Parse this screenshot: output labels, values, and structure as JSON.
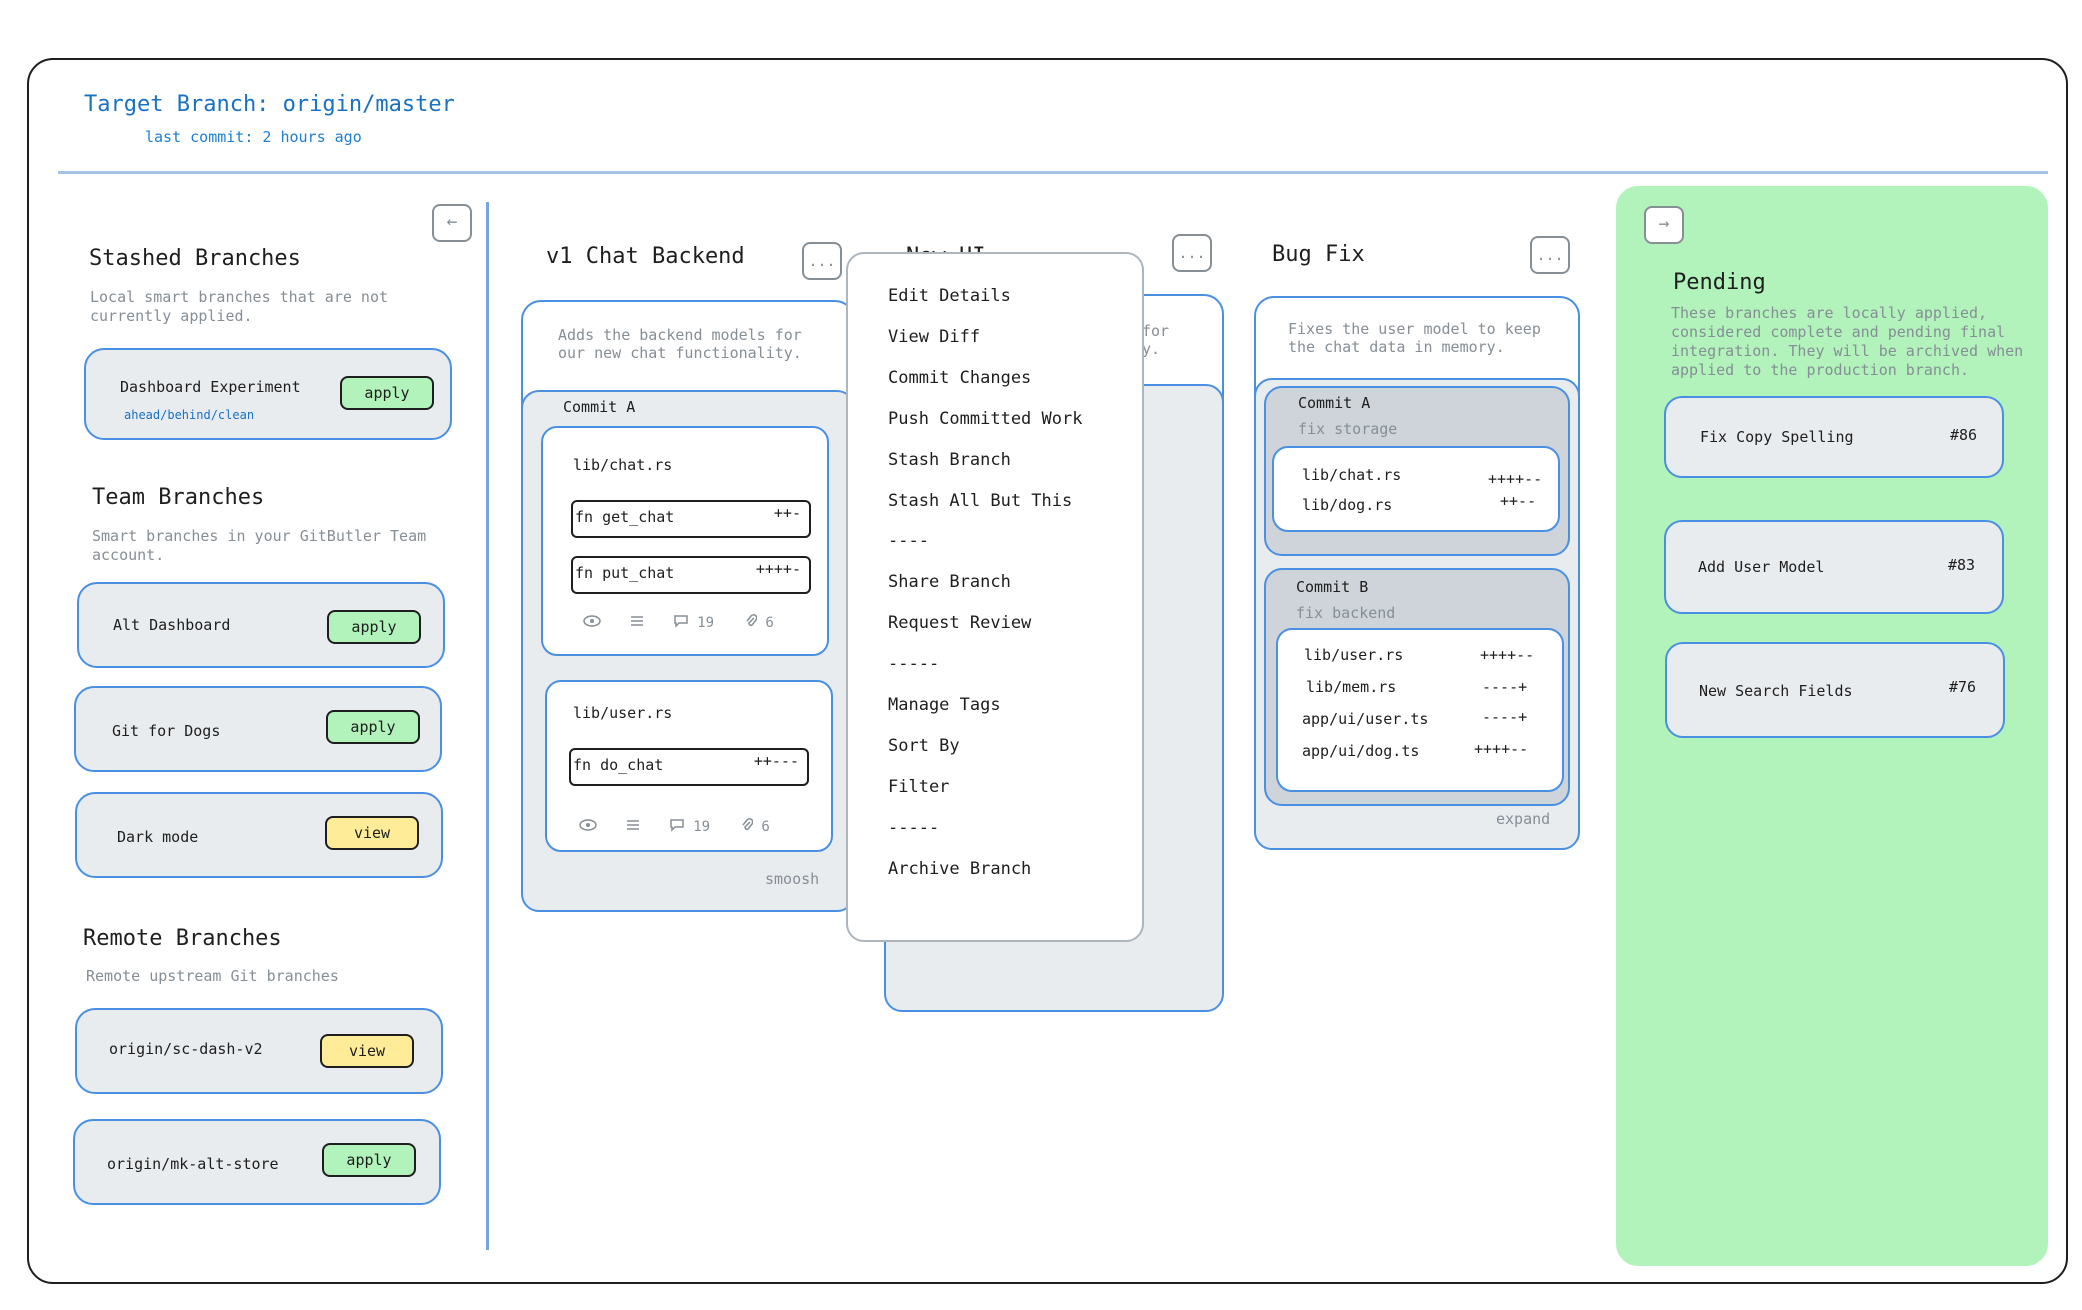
{
  "header": {
    "title": "Target Branch: origin/master",
    "subtitle": "last commit: 2 hours ago"
  },
  "sidebar": {
    "collapse_icon": "←",
    "stashed": {
      "title": "Stashed Branches",
      "desc_line1": "Local smart branches that are not",
      "desc_line2": "currently applied.",
      "items": [
        {
          "name": "Dashboard Experiment",
          "status": "ahead/behind/clean",
          "action": "apply"
        }
      ]
    },
    "team": {
      "title": "Team Branches",
      "desc_line1": "Smart branches in your GitButler Team",
      "desc_line2": "account.",
      "items": [
        {
          "name": "Alt Dashboard",
          "action": "apply"
        },
        {
          "name": "Git for Dogs",
          "action": "apply"
        },
        {
          "name": "Dark mode",
          "action": "view"
        }
      ]
    },
    "remote": {
      "title": "Remote Branches",
      "desc": "Remote upstream Git branches",
      "items": [
        {
          "name": "origin/sc-dash-v2",
          "action": "view"
        },
        {
          "name": "origin/mk-alt-store",
          "action": "apply"
        }
      ]
    }
  },
  "lanes": {
    "chat": {
      "title": "v1 Chat Backend",
      "more": "...",
      "desc_line1": "Adds the backend models for",
      "desc_line2": "our new chat functionality.",
      "commit": "Commit A",
      "files": [
        {
          "path": "lib/chat.rs",
          "fns": [
            {
              "name": "fn get_chat",
              "diff": "++-"
            },
            {
              "name": "fn put_chat",
              "diff": "++++-"
            }
          ],
          "comments": "19",
          "attachments": "6"
        },
        {
          "path": "lib/user.rs",
          "fns": [
            {
              "name": "fn do_chat",
              "diff": "++---"
            }
          ],
          "comments": "19",
          "attachments": "6"
        }
      ],
      "footer": "smoosh"
    },
    "newui": {
      "title": "New UI",
      "more": "...",
      "desc_line1": "for",
      "desc_line2": "y."
    },
    "bugfix": {
      "title": "Bug Fix",
      "more": "...",
      "desc_line1": "Fixes the user model to keep",
      "desc_line2": "the chat data in memory.",
      "commits": [
        {
          "label": "Commit A",
          "sub": "fix storage",
          "files": [
            {
              "path": "lib/chat.rs",
              "diff": "++++--"
            },
            {
              "path": "lib/dog.rs",
              "diff": "++--"
            }
          ]
        },
        {
          "label": "Commit B",
          "sub": "fix backend",
          "files": [
            {
              "path": "lib/user.rs",
              "diff": "++++--"
            },
            {
              "path": "lib/mem.rs",
              "diff": "----+"
            },
            {
              "path": "app/ui/user.ts",
              "diff": "----+"
            },
            {
              "path": "app/ui/dog.ts",
              "diff": "++++--"
            }
          ]
        }
      ],
      "footer": "expand"
    }
  },
  "context_menu": {
    "items": [
      "Edit Details",
      "View Diff",
      "Commit Changes",
      "Push Committed Work",
      "Stash Branch",
      "Stash All But This",
      "----",
      "Share Branch",
      "Request Review",
      "-----",
      "Manage Tags",
      "Sort By",
      "Filter",
      "-----",
      "Archive Branch"
    ]
  },
  "pending": {
    "expand_icon": "→",
    "title": "Pending",
    "desc_lines": [
      "These branches are locally applied,",
      "considered complete and pending final",
      "integration. They will be archived when",
      "applied to the production branch."
    ],
    "items": [
      {
        "name": "Fix Copy Spelling",
        "number": "#86"
      },
      {
        "name": "Add User Model",
        "number": "#83"
      },
      {
        "name": "New Search Fields",
        "number": "#76"
      }
    ]
  },
  "colors": {
    "accent_blue": "#1971c2",
    "card_border": "#4a90e2",
    "apply_green": "#b2f2bb",
    "view_yellow": "#ffec99",
    "pending_bg": "#b2f2bb"
  },
  "icons": {
    "eye": "eye-icon",
    "lines": "list-icon",
    "comment": "comment-icon",
    "paperclip": "paperclip-icon"
  }
}
